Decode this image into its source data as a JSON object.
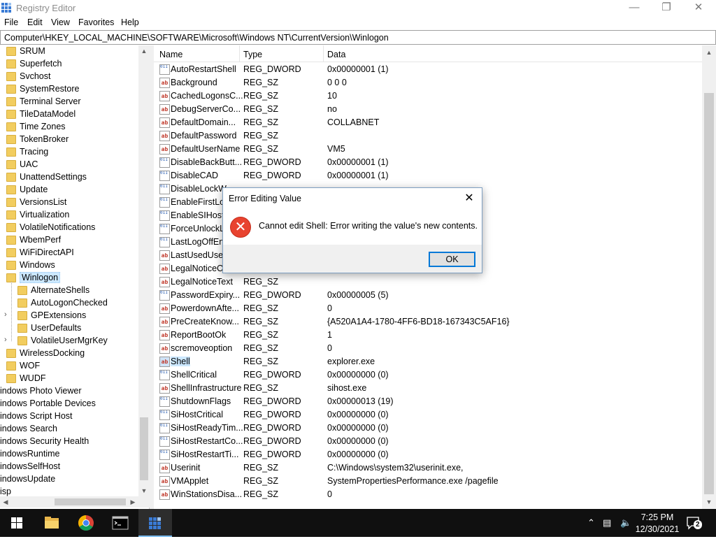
{
  "window": {
    "title": "Registry Editor"
  },
  "menu": [
    "File",
    "Edit",
    "View",
    "Favorites",
    "Help"
  ],
  "address": "Computer\\HKEY_LOCAL_MACHINE\\SOFTWARE\\Microsoft\\Windows NT\\CurrentVersion\\Winlogon",
  "tree": {
    "level1": [
      "SRUM",
      "Superfetch",
      "Svchost",
      "SystemRestore",
      "Terminal Server",
      "TileDataModel",
      "Time Zones",
      "TokenBroker",
      "Tracing",
      "UAC",
      "UnattendSettings",
      "Update",
      "VersionsList",
      "Virtualization",
      "VolatileNotifications",
      "WbemPerf",
      "WiFiDirectAPI",
      "Windows",
      "Winlogon"
    ],
    "winlogon_children": [
      "AlternateShells",
      "AutoLogonChecked",
      "GPExtensions",
      "UserDefaults",
      "VolatileUserMgrKey"
    ],
    "level1_after": [
      "WirelessDocking",
      "WOF",
      "WUDF"
    ],
    "level0": [
      "indows Photo Viewer",
      "indows Portable Devices",
      "indows Script Host",
      "indows Search",
      "indows Security Health",
      "indowsRuntime",
      "indowsSelfHost",
      "indowsUpdate",
      "isp"
    ],
    "selected": "Winlogon"
  },
  "columns": {
    "name": "Name",
    "type": "Type",
    "data": "Data"
  },
  "values": [
    {
      "name": "AutoRestartShell",
      "type": "REG_DWORD",
      "data": "0x00000001 (1)",
      "icon": "dword"
    },
    {
      "name": "Background",
      "type": "REG_SZ",
      "data": "0 0 0",
      "icon": "sz"
    },
    {
      "name": "CachedLogonsC...",
      "type": "REG_SZ",
      "data": "10",
      "icon": "sz"
    },
    {
      "name": "DebugServerCo...",
      "type": "REG_SZ",
      "data": "no",
      "icon": "sz"
    },
    {
      "name": "DefaultDomain...",
      "type": "REG_SZ",
      "data": "COLLABNET",
      "icon": "sz"
    },
    {
      "name": "DefaultPassword",
      "type": "REG_SZ",
      "data": "",
      "icon": "sz"
    },
    {
      "name": "DefaultUserName",
      "type": "REG_SZ",
      "data": "VM5",
      "icon": "sz"
    },
    {
      "name": "DisableBackButt...",
      "type": "REG_DWORD",
      "data": "0x00000001 (1)",
      "icon": "dword"
    },
    {
      "name": "DisableCAD",
      "type": "REG_DWORD",
      "data": "0x00000001 (1)",
      "icon": "dword"
    },
    {
      "name": "DisableLockW",
      "type": "",
      "data": "",
      "icon": "dword"
    },
    {
      "name": "EnableFirstLog",
      "type": "",
      "data": "",
      "icon": "dword"
    },
    {
      "name": "EnableSIHostI",
      "type": "",
      "data": "",
      "icon": "dword"
    },
    {
      "name": "ForceUnlockL",
      "type": "",
      "data": "",
      "icon": "dword"
    },
    {
      "name": "LastLogOffEnd",
      "type": "",
      "data": "",
      "icon": "dword"
    },
    {
      "name": "LastUsedUser",
      "type": "",
      "data": "",
      "icon": "sz"
    },
    {
      "name": "LegalNoticeCa",
      "type": "",
      "data": "",
      "icon": "sz"
    },
    {
      "name": "LegalNoticeText",
      "type": "REG_SZ",
      "data": "",
      "icon": "sz"
    },
    {
      "name": "PasswordExpiry...",
      "type": "REG_DWORD",
      "data": "0x00000005 (5)",
      "icon": "dword"
    },
    {
      "name": "PowerdownAfte...",
      "type": "REG_SZ",
      "data": "0",
      "icon": "sz"
    },
    {
      "name": "PreCreateKnow...",
      "type": "REG_SZ",
      "data": "{A520A1A4-1780-4FF6-BD18-167343C5AF16}",
      "icon": "sz"
    },
    {
      "name": "ReportBootOk",
      "type": "REG_SZ",
      "data": "1",
      "icon": "sz"
    },
    {
      "name": "scremoveoption",
      "type": "REG_SZ",
      "data": "0",
      "icon": "sz"
    },
    {
      "name": "Shell",
      "type": "REG_SZ",
      "data": "explorer.exe",
      "icon": "sz",
      "selected": true
    },
    {
      "name": "ShellCritical",
      "type": "REG_DWORD",
      "data": "0x00000000 (0)",
      "icon": "dword"
    },
    {
      "name": "ShellInfrastructure",
      "type": "REG_SZ",
      "data": "sihost.exe",
      "icon": "sz"
    },
    {
      "name": "ShutdownFlags",
      "type": "REG_DWORD",
      "data": "0x00000013 (19)",
      "icon": "dword"
    },
    {
      "name": "SiHostCritical",
      "type": "REG_DWORD",
      "data": "0x00000000 (0)",
      "icon": "dword"
    },
    {
      "name": "SiHostReadyTim...",
      "type": "REG_DWORD",
      "data": "0x00000000 (0)",
      "icon": "dword"
    },
    {
      "name": "SiHostRestartCo...",
      "type": "REG_DWORD",
      "data": "0x00000000 (0)",
      "icon": "dword"
    },
    {
      "name": "SiHostRestartTi...",
      "type": "REG_DWORD",
      "data": "0x00000000 (0)",
      "icon": "dword"
    },
    {
      "name": "Userinit",
      "type": "REG_SZ",
      "data": "C:\\Windows\\system32\\userinit.exe,",
      "icon": "sz"
    },
    {
      "name": "VMApplet",
      "type": "REG_SZ",
      "data": "SystemPropertiesPerformance.exe /pagefile",
      "icon": "sz"
    },
    {
      "name": "WinStationsDisa...",
      "type": "REG_SZ",
      "data": "0",
      "icon": "sz"
    }
  ],
  "dialog": {
    "title": "Error Editing Value",
    "message": "Cannot edit Shell:  Error writing the value's new contents.",
    "ok_label": "OK",
    "close_glyph": "✕",
    "error_glyph": "✕"
  },
  "taskbar": {
    "time": "7:25 PM",
    "date": "12/30/2021",
    "notification_count": "2",
    "apps": [
      "start-icon",
      "file-explorer-icon",
      "chrome-icon",
      "command-prompt-icon",
      "registry-editor-icon"
    ]
  },
  "colors": {
    "accent": "#0078d7",
    "selection": "#cce8ff",
    "folder": "#f2cd5f",
    "error": "#e8432f"
  }
}
